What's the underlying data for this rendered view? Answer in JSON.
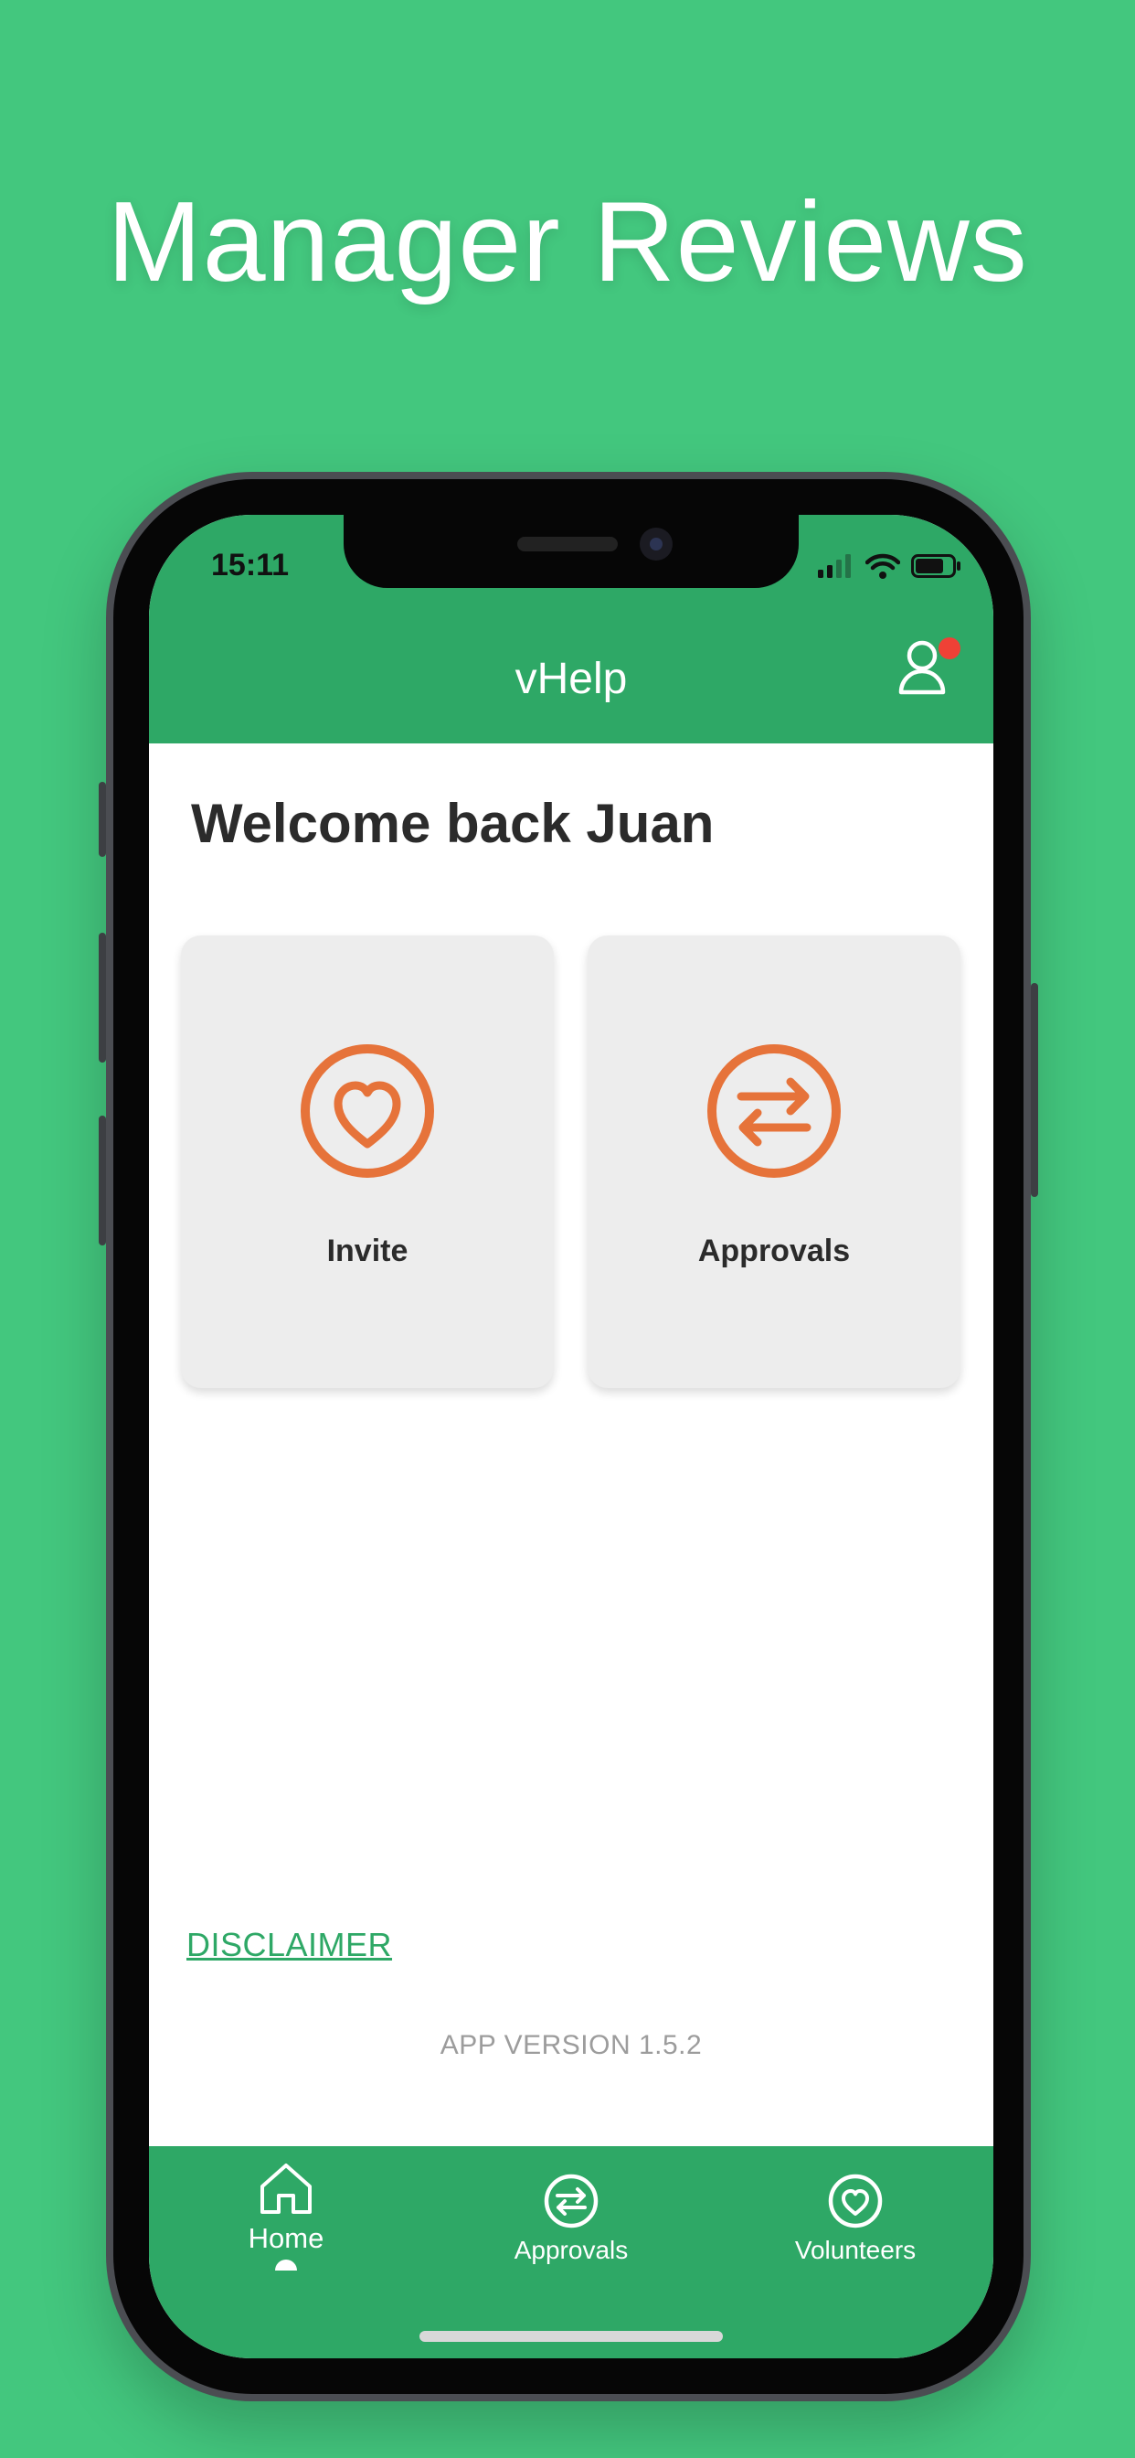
{
  "headline": "Manager Reviews",
  "status_bar": {
    "time": "15:11"
  },
  "app": {
    "title": "vHelp"
  },
  "welcome": "Welcome back Juan",
  "cards": [
    {
      "label": "Invite",
      "icon": "heart-icon"
    },
    {
      "label": "Approvals",
      "icon": "swap-arrows-icon"
    }
  ],
  "footer": {
    "disclaimer": "DISCLAIMER",
    "version": "APP VERSION 1.5.2"
  },
  "tabs": [
    {
      "label": "Home",
      "icon": "home-icon",
      "active": true
    },
    {
      "label": "Approvals",
      "icon": "swap-arrows-icon",
      "active": false
    },
    {
      "label": "Volunteers",
      "icon": "heart-icon",
      "active": false
    }
  ],
  "colors": {
    "background": "#43c77e",
    "header": "#2ea866",
    "accent_icon": "#e6733a",
    "notification": "#ef4136"
  }
}
